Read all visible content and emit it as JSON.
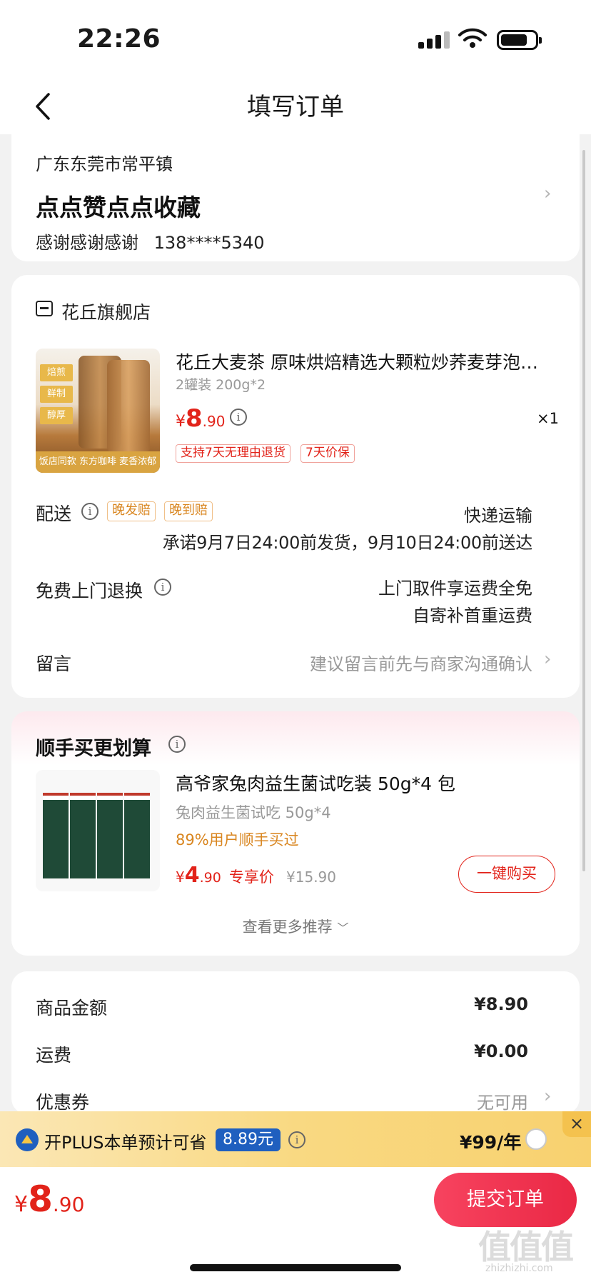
{
  "status_bar": {
    "time": "22:26"
  },
  "nav": {
    "title": "填写订单"
  },
  "address": {
    "region": "广东东莞市常平镇",
    "title": "点点赞点点收藏",
    "name": "感谢感谢感谢",
    "phone": "138****5340"
  },
  "store": {
    "name": "花丘旗舰店",
    "product": {
      "title": "花丘大麦茶 原味烘焙精选大颗粒炒荞麦芽泡…",
      "spec": "2罐装 200g*2",
      "price_currency": "¥",
      "price_int": "8",
      "price_dec": ".90",
      "qty": "×1",
      "tags": [
        "支持7天无理由退货",
        "7天价保"
      ],
      "image_tags": [
        "焙煎",
        "鲜制",
        "醇厚"
      ],
      "image_footer": "饭店同款 东方咖啡 麦香浓郁"
    },
    "delivery": {
      "label": "配送",
      "tags": [
        "晚发赔",
        "晚到赔"
      ],
      "method": "快递运输",
      "promise": "承诺9月7日24:00前发货，9月10日24:00前送达"
    },
    "return": {
      "label": "免费上门退换",
      "line1": "上门取件享运费全免",
      "line2": "自寄补首重运费"
    },
    "message": {
      "label": "留言",
      "placeholder": "建议留言前先与商家沟通确认"
    }
  },
  "recommend": {
    "title": "顺手买更划算",
    "item": {
      "name": "高爷家兔肉益生菌试吃装 50g*4 包",
      "sub": "兔肉益生菌试吃 50g*4",
      "stat": "89%用户顺手买过",
      "price_currency": "¥",
      "price_int": "4",
      "price_dec": ".90",
      "price_label": "专享价",
      "orig_price": "¥15.90",
      "buy_label": "一键购买"
    },
    "more_label": "查看更多推荐"
  },
  "summary": {
    "goods_label": "商品金额",
    "goods_value": "¥8.90",
    "shipping_label": "运费",
    "shipping_value": "¥0.00",
    "coupon_label": "优惠券",
    "coupon_value": "无可用"
  },
  "plus": {
    "text": "开PLUS本单预计可省",
    "save": "8.89元",
    "price": "¥99/年"
  },
  "bottom": {
    "total_currency": "¥",
    "total_int": "8",
    "total_dec": ".90",
    "submit_label": "提交订单"
  },
  "watermark": {
    "text": "值值值",
    "sub": "zhizhizhi.com"
  },
  "colors": {
    "accent_red": "#e2231a",
    "plus_blue": "#1f5fbf",
    "tag_orange": "#d98620",
    "submit_gradient": [
      "#f7435f",
      "#ea2845"
    ]
  }
}
